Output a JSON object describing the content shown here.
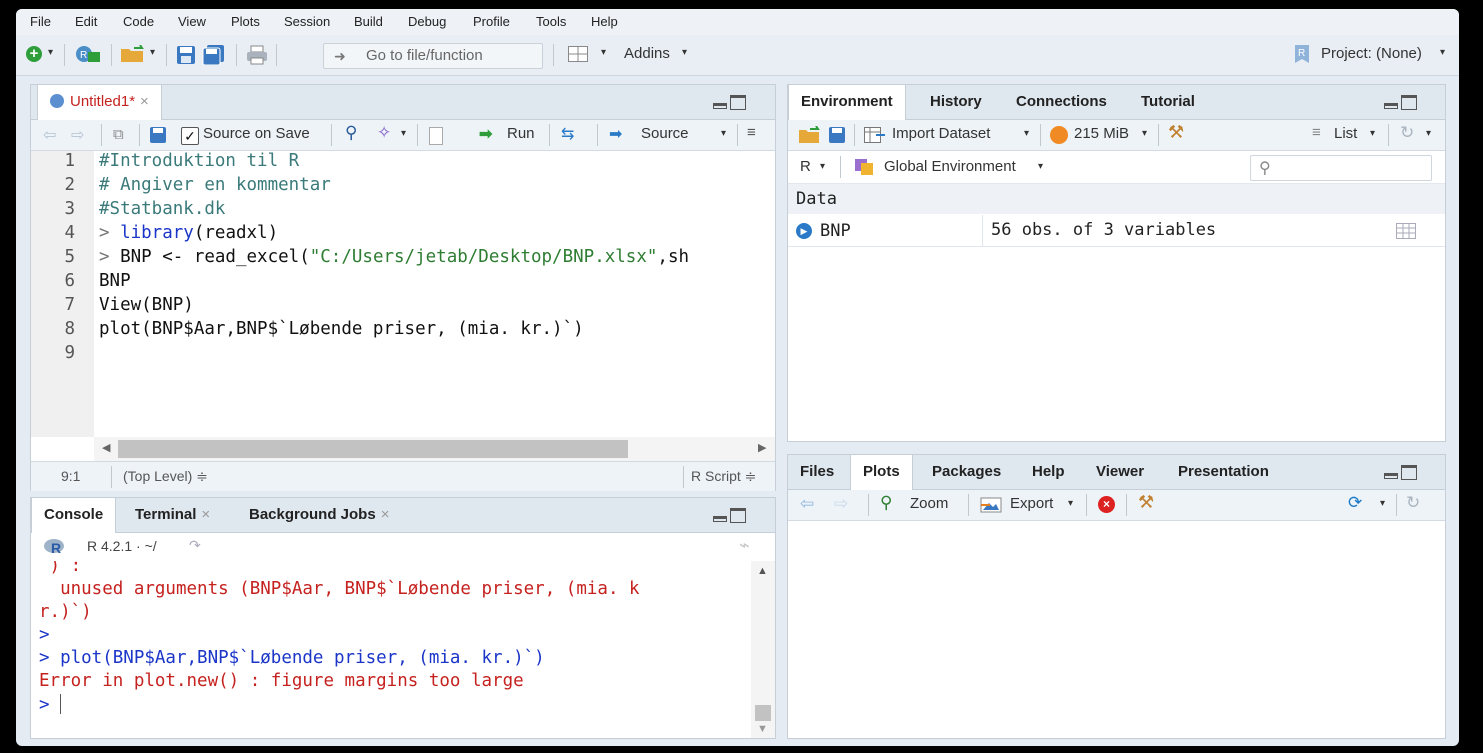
{
  "menubar": [
    "File",
    "Edit",
    "Code",
    "View",
    "Plots",
    "Session",
    "Build",
    "Debug",
    "Profile",
    "Tools",
    "Help"
  ],
  "toolbar": {
    "goto_placeholder": "Go to file/function",
    "addins": "Addins",
    "project": "Project: (None)"
  },
  "editor": {
    "tab": "Untitled1*",
    "tab_close": "×",
    "source_on_save": "Source on Save",
    "run": "Run",
    "source": "Source",
    "lines": [
      {
        "n": "1",
        "text": "#Introduktion til R"
      },
      {
        "n": "2",
        "text": "# Angiver en kommentar"
      },
      {
        "n": "3",
        "text": "#Statbank.dk"
      },
      {
        "n": "4",
        "prompt": "> ",
        "fn": "library",
        "rest": "(readxl)"
      },
      {
        "n": "5",
        "prompt": "> ",
        "pre": "BNP <- read_excel(",
        "str": "\"C:/Users/jetab/Desktop/BNP.xlsx\"",
        "post": ",sh"
      },
      {
        "n": "6",
        "text": "BNP"
      },
      {
        "n": "7",
        "text": "View(BNP)"
      },
      {
        "n": "8",
        "text": "plot(BNP$Aar,BNP$`Løbende priser, (mia. kr.)`)"
      },
      {
        "n": "9",
        "text": ""
      }
    ],
    "status": {
      "pos": "9:1",
      "scope": "(Top Level) ≑",
      "type": "R Script ≑"
    }
  },
  "console": {
    "tabs": [
      {
        "label": "Console"
      },
      {
        "label": "Terminal",
        "close": "×"
      },
      {
        "label": "Background Jobs",
        "close": "×"
      }
    ],
    "version": "R 4.2.1 · ~/",
    "lines": [
      {
        "cls": "red",
        "text": " ) :"
      },
      {
        "cls": "red",
        "text": "  unused arguments (BNP$Aar, BNP$`Løbende priser, (mia. k"
      },
      {
        "cls": "red",
        "text": "r.)`)"
      },
      {
        "cls": "blue",
        "text": ">"
      },
      {
        "cls": "blue",
        "text": "> plot(BNP$Aar,BNP$`Løbende priser, (mia. kr.)`)"
      },
      {
        "cls": "red",
        "text": "Error in plot.new() : figure margins too large"
      },
      {
        "cls": "blue",
        "text": "> "
      }
    ]
  },
  "env": {
    "tabs": [
      "Environment",
      "History",
      "Connections",
      "Tutorial"
    ],
    "import_dataset": "Import Dataset",
    "memory": "215 MiB",
    "list": "List",
    "lang": "R",
    "global_env": "Global Environment",
    "search_placeholder": "",
    "section": "Data",
    "rows": [
      {
        "name": "BNP",
        "value": "56 obs. of 3 variables"
      }
    ]
  },
  "files": {
    "tabs": [
      "Files",
      "Plots",
      "Packages",
      "Help",
      "Viewer",
      "Presentation"
    ],
    "zoom": "Zoom",
    "export": "Export"
  }
}
